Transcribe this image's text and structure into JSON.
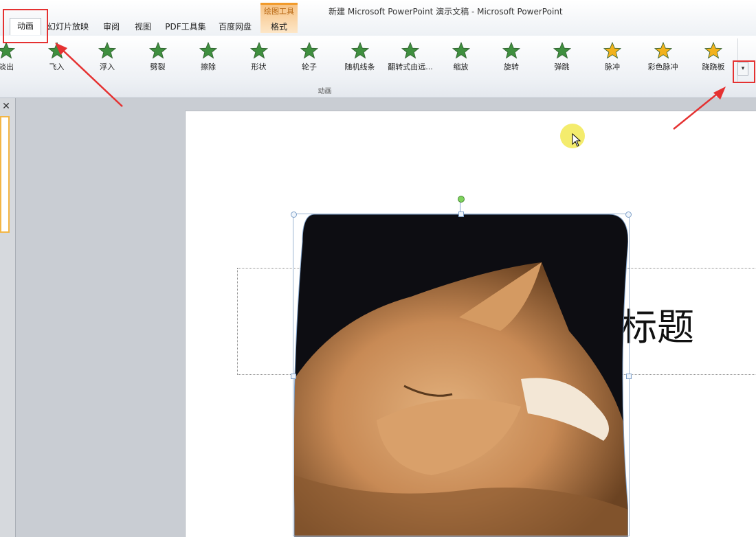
{
  "window": {
    "title": "新建 Microsoft PowerPoint 演示文稿 - Microsoft PowerPoint"
  },
  "contextual_tab": {
    "group_label": "绘图工具",
    "tab_label": "格式"
  },
  "tabs": [
    {
      "label": "动画",
      "active": true
    },
    {
      "label": "幻灯片放映"
    },
    {
      "label": "审阅"
    },
    {
      "label": "视图"
    },
    {
      "label": "PDF工具集"
    },
    {
      "label": "百度网盘"
    }
  ],
  "ribbon": {
    "group_label": "动画",
    "effects": [
      {
        "label": "淡出",
        "icon": "star-fade-icon",
        "color": "#3f8f3f"
      },
      {
        "label": "飞入",
        "icon": "star-fly-in-icon",
        "color": "#3f8f3f"
      },
      {
        "label": "浮入",
        "icon": "star-float-in-icon",
        "color": "#3f8f3f"
      },
      {
        "label": "劈裂",
        "icon": "star-split-icon",
        "color": "#3f8f3f"
      },
      {
        "label": "擦除",
        "icon": "star-wipe-icon",
        "color": "#3f8f3f"
      },
      {
        "label": "形状",
        "icon": "star-shape-icon",
        "color": "#3f8f3f"
      },
      {
        "label": "轮子",
        "icon": "star-wheel-icon",
        "color": "#3f8f3f"
      },
      {
        "label": "随机线条",
        "icon": "star-random-bars-icon",
        "color": "#3f8f3f"
      },
      {
        "label": "翻转式由远...",
        "icon": "star-grow-turn-icon",
        "color": "#3f8f3f"
      },
      {
        "label": "缩放",
        "icon": "star-zoom-icon",
        "color": "#3f8f3f"
      },
      {
        "label": "旋转",
        "icon": "star-swivel-icon",
        "color": "#3f8f3f"
      },
      {
        "label": "弹跳",
        "icon": "star-bounce-icon",
        "color": "#3f8f3f"
      },
      {
        "label": "脉冲",
        "icon": "star-pulse-icon",
        "color": "#f2b21c"
      },
      {
        "label": "彩色脉冲",
        "icon": "star-color-pulse-icon",
        "color": "#f2b21c"
      },
      {
        "label": "跷跷板",
        "icon": "star-teeter-icon",
        "color": "#f2b21c"
      }
    ],
    "more_button": "▾"
  },
  "left_panel": {
    "close": "✕"
  },
  "slide": {
    "title_text": "标题"
  },
  "annotation_color": "#e53131"
}
